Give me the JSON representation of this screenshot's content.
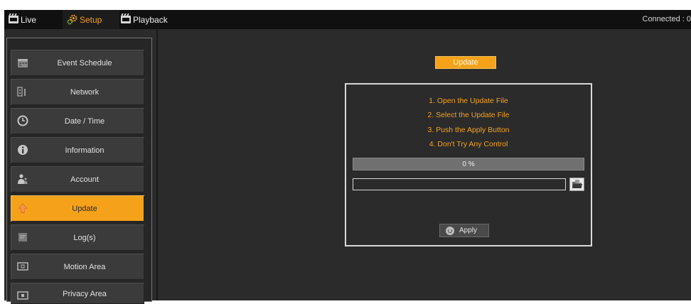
{
  "topbar": {
    "tabs": [
      {
        "label": "Live",
        "icon": "live-icon"
      },
      {
        "label": "Setup",
        "icon": "gear-icon",
        "active": true
      },
      {
        "label": "Playback",
        "icon": "playback-icon"
      }
    ],
    "connected": "Connected : 0"
  },
  "sidebar": {
    "items": [
      {
        "label": "Event Schedule",
        "icon": "calendar-icon"
      },
      {
        "label": "Network",
        "icon": "network-icon"
      },
      {
        "label": "Date / Time",
        "icon": "clock-icon"
      },
      {
        "label": "Information",
        "icon": "info-icon"
      },
      {
        "label": "Account",
        "icon": "users-icon"
      },
      {
        "label": "Update",
        "icon": "update-icon",
        "active": true
      },
      {
        "label": "Log(s)",
        "icon": "log-icon"
      },
      {
        "label": "Motion Area",
        "icon": "motion-icon"
      },
      {
        "label": "Privacy Area",
        "icon": "privacy-icon"
      }
    ]
  },
  "main": {
    "update_title": "Update",
    "steps": [
      "1. Open the Update File",
      "2. Select the Update File",
      "3. Push the Apply Button",
      "4. Don't Try Any Control"
    ],
    "progress": {
      "percent": 0,
      "label": "0 %"
    },
    "file_value": "",
    "apply_label": "Apply"
  },
  "colors": {
    "accent": "#f5a21a",
    "background": "#2b2b2b",
    "topbar": "#101010"
  }
}
